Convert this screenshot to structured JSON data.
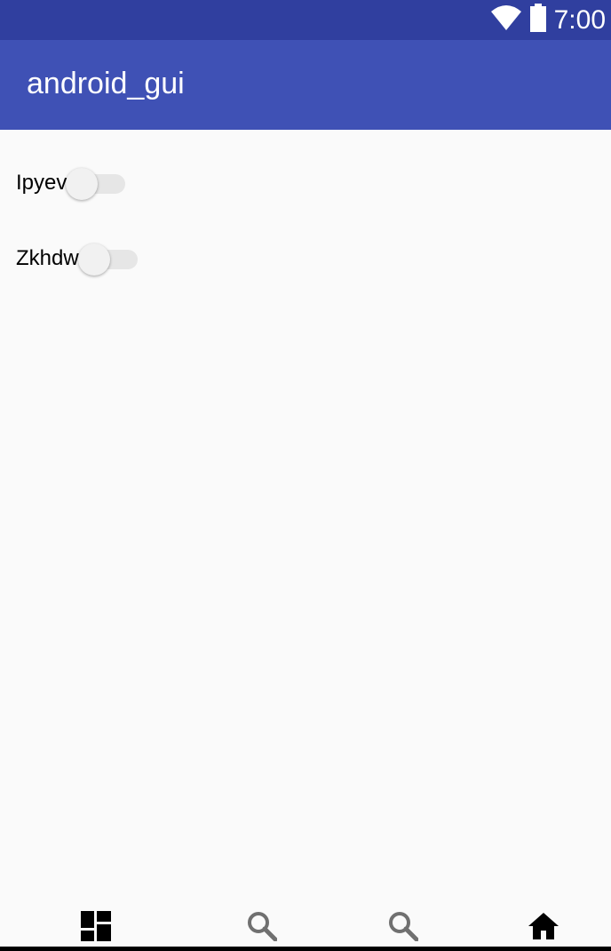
{
  "status_bar": {
    "time": "7:00",
    "wifi_icon": "wifi-icon",
    "battery_icon": "battery-icon",
    "background": "#303f9f"
  },
  "app_bar": {
    "title": "android_gui",
    "background": "#3f51b5"
  },
  "toggles": [
    {
      "label": "Ipyev",
      "on": false
    },
    {
      "label": "Zkhdw",
      "on": false
    }
  ],
  "bottom_nav": {
    "items": [
      {
        "icon": "dashboard-icon"
      },
      {
        "icon": "search-icon"
      },
      {
        "icon": "search-icon"
      },
      {
        "icon": "home-icon"
      }
    ]
  }
}
